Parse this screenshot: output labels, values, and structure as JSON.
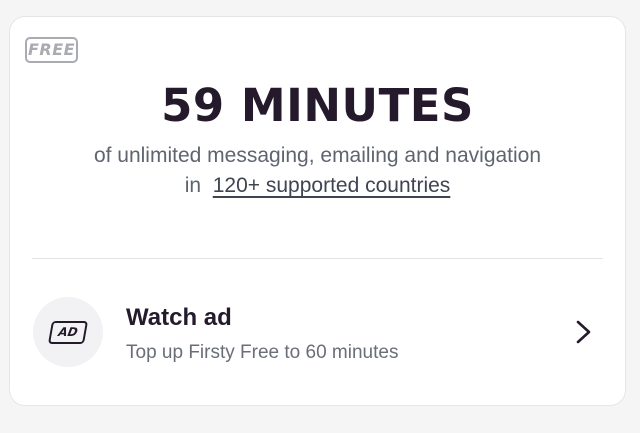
{
  "badge": {
    "label": "FREE"
  },
  "headline": {
    "value": "59 MINUTES"
  },
  "description": {
    "line1": "of unlimited messaging, emailing and navigation",
    "line2_prefix": "in",
    "link": "120+ supported countries"
  },
  "ad_action": {
    "icon_text": "AD",
    "title": "Watch ad",
    "subtitle": "Top up Firsty Free to 60 minutes",
    "icon": "chevron-right-icon"
  },
  "colors": {
    "primary_text": "#241a2c",
    "secondary_text": "#5f6470",
    "badge": "#a9abb1"
  }
}
